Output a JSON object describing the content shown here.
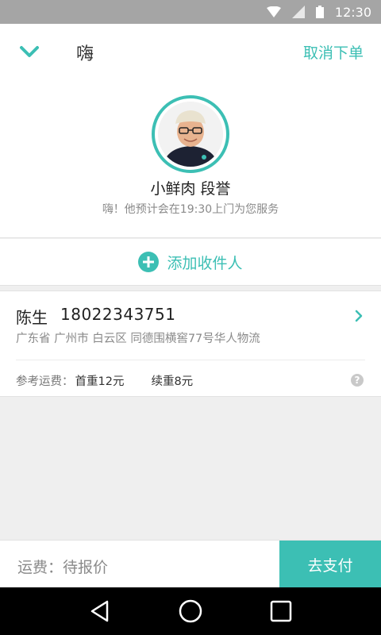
{
  "status_bar": {
    "time": "12:30",
    "icons": [
      "wifi-icon",
      "signal-icon",
      "battery-icon"
    ]
  },
  "header": {
    "title": "嗨",
    "cancel_label": "取消下单",
    "back_icon": "chevron-down-icon"
  },
  "courier": {
    "name": "小鲜肉 段誉",
    "message": "嗨！他预计会在19:30上门为您服务",
    "avatar": "courier-avatar"
  },
  "add_recipient": {
    "label": "添加收件人",
    "icon": "plus-circle-icon"
  },
  "recipient": {
    "name": "陈生",
    "phone": "18022343751",
    "address": "广东省 广州市 白云区 同德围横窖77号华人物流"
  },
  "fees": {
    "label": "参考运费：",
    "first_weight": "首重12元",
    "continued_weight": "续重8元",
    "help_icon": "question-icon"
  },
  "footer": {
    "shipping_status": "运费：待报价",
    "pay_label": "去支付"
  },
  "nav": [
    "back-triangle-icon",
    "home-circle-icon",
    "recents-square-icon"
  ],
  "colors": {
    "accent": "#3cbfb4",
    "status_bar": "#a5a5a5",
    "background": "#efefef"
  }
}
